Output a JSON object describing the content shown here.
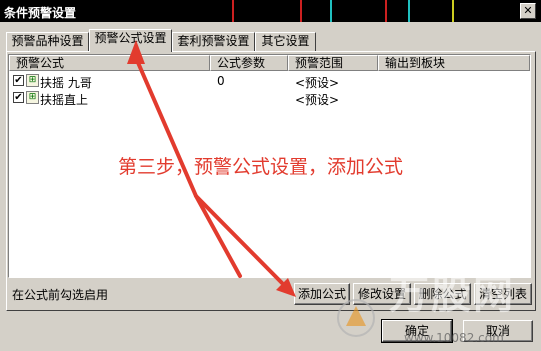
{
  "window": {
    "title": "条件预警设置",
    "close_glyph": "✕"
  },
  "tabs": [
    {
      "label": "预警品种设置",
      "active": false
    },
    {
      "label": "预警公式设置",
      "active": true
    },
    {
      "label": "套利预警设置",
      "active": false
    },
    {
      "label": "其它设置",
      "active": false
    }
  ],
  "list": {
    "columns": [
      "预警公式",
      "公式参数",
      "预警范围",
      "输出到板块"
    ],
    "rows": [
      {
        "checked": true,
        "name": "扶摇 九哥",
        "param": "0",
        "range": "<预设>"
      },
      {
        "checked": true,
        "name": "扶摇直上",
        "param": "",
        "range": "<预设>"
      }
    ]
  },
  "hint": "在公式前勾选启用",
  "buttons": {
    "add": "添加公式",
    "edit": "修改设置",
    "delete": "删除公式",
    "clear": "清空列表",
    "ok": "确定",
    "cancel": "取消"
  },
  "annotation": "第三步，预警公式设置，添加公式",
  "watermark": {
    "brand": "万股网",
    "url": "www.10082.com"
  },
  "colors": {
    "annotation": "#e23b2e",
    "titlebar": "#000000",
    "dialog": "#d4d0c8"
  }
}
